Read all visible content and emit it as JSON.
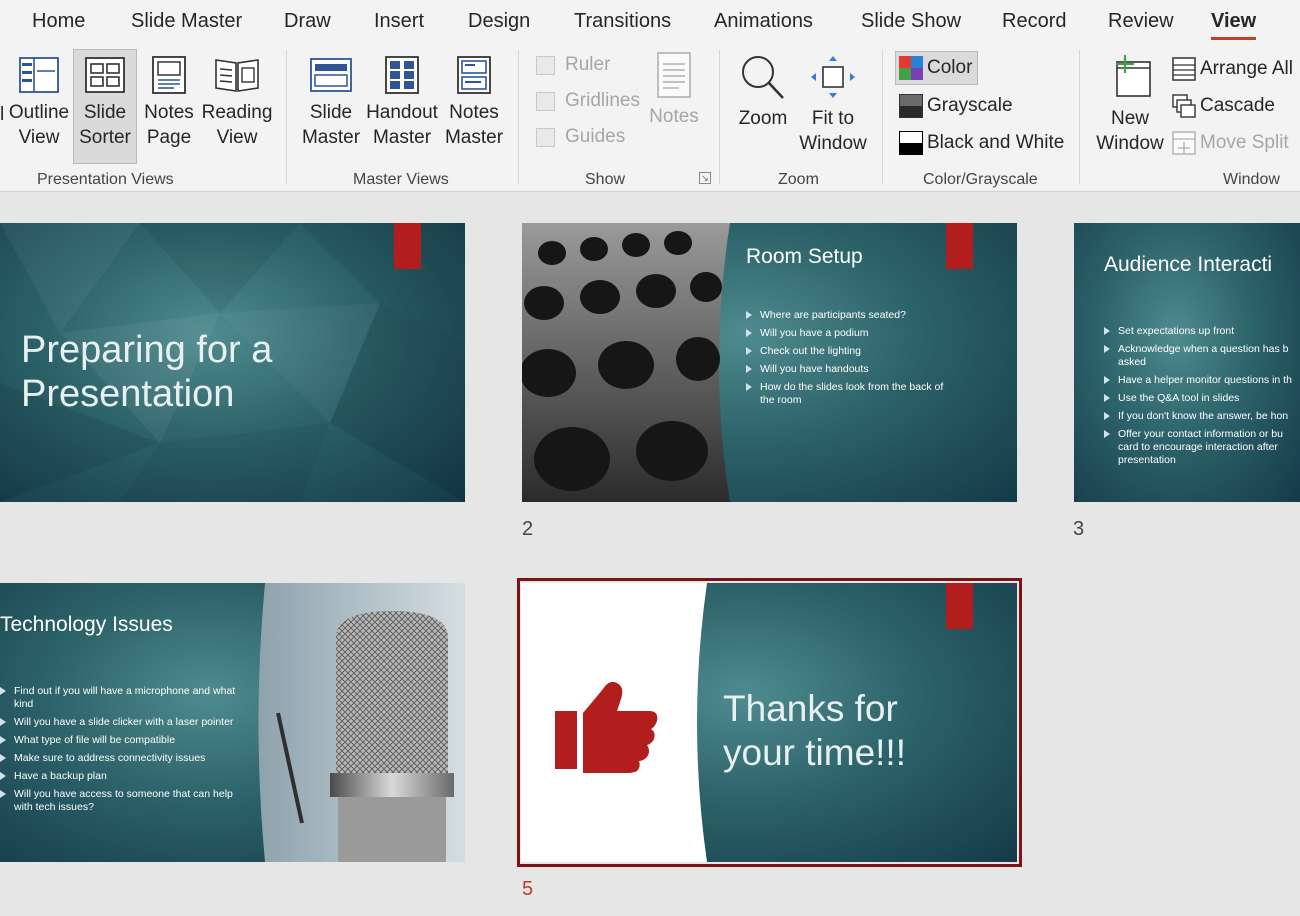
{
  "tabs": [
    "Home",
    "Slide Master",
    "Draw",
    "Insert",
    "Design",
    "Transitions",
    "Animations",
    "Slide Show",
    "Record",
    "Review",
    "View"
  ],
  "active_tab": "View",
  "ribbon": {
    "presentation_views": {
      "label": "Presentation Views",
      "normal_label": "l",
      "outline": [
        "Outline",
        "View"
      ],
      "slide_sorter": [
        "Slide",
        "Sorter"
      ],
      "notes_page": [
        "Notes",
        "Page"
      ],
      "reading_view": [
        "Reading",
        "View"
      ]
    },
    "master_views": {
      "label": "Master Views",
      "slide_master": [
        "Slide",
        "Master"
      ],
      "handout_master": [
        "Handout",
        "Master"
      ],
      "notes_master": [
        "Notes",
        "Master"
      ]
    },
    "show": {
      "label": "Show",
      "ruler": "Ruler",
      "gridlines": "Gridlines",
      "guides": "Guides",
      "notes": "Notes"
    },
    "zoom": {
      "label": "Zoom",
      "zoom": "Zoom",
      "fit_to_window": [
        "Fit to",
        "Window"
      ]
    },
    "color_grayscale": {
      "label": "Color/Grayscale",
      "color": "Color",
      "grayscale": "Grayscale",
      "black_and_white": "Black and White"
    },
    "window": {
      "label": "Window",
      "new_window": [
        "New",
        "Window"
      ],
      "arrange_all": "Arrange All",
      "cascade": "Cascade",
      "move_split": "Move Split"
    }
  },
  "slides": {
    "s1": {
      "title_lines": [
        "Preparing for a",
        "Presentation"
      ]
    },
    "s2": {
      "number": "2",
      "title": "Room Setup",
      "bullets": [
        "Where are participants seated?",
        "Will you have a podium",
        "Check out the lighting",
        "Will you have handouts",
        "How do the slides look from the back of the room"
      ]
    },
    "s3": {
      "number": "3",
      "title": "Audience Interacti",
      "bullets": [
        "Set expectations up front",
        "Acknowledge when a question has b asked",
        "Have a helper monitor questions in th",
        "Use the Q&A tool in slides",
        "If you don't know the answer, be hon",
        "Offer your contact information or bu card to encourage interaction after presentation"
      ]
    },
    "s4": {
      "title": "Technology Issues",
      "bullets": [
        "Find out if you will have a microphone and what kind",
        "Will you have a slide clicker with a laser pointer",
        "What type of file will be compatible",
        "Make sure to address connectivity issues",
        "Have a backup plan",
        "Will you have access to someone that can help with tech issues?"
      ]
    },
    "s5": {
      "number": "5",
      "title_lines": [
        "Thanks for",
        "your time!!!"
      ]
    }
  },
  "colors": {
    "accent": "#b7472a",
    "slide_red": "#b21e1e",
    "teal_dark": "#143a48",
    "selection": "#7a1416"
  }
}
